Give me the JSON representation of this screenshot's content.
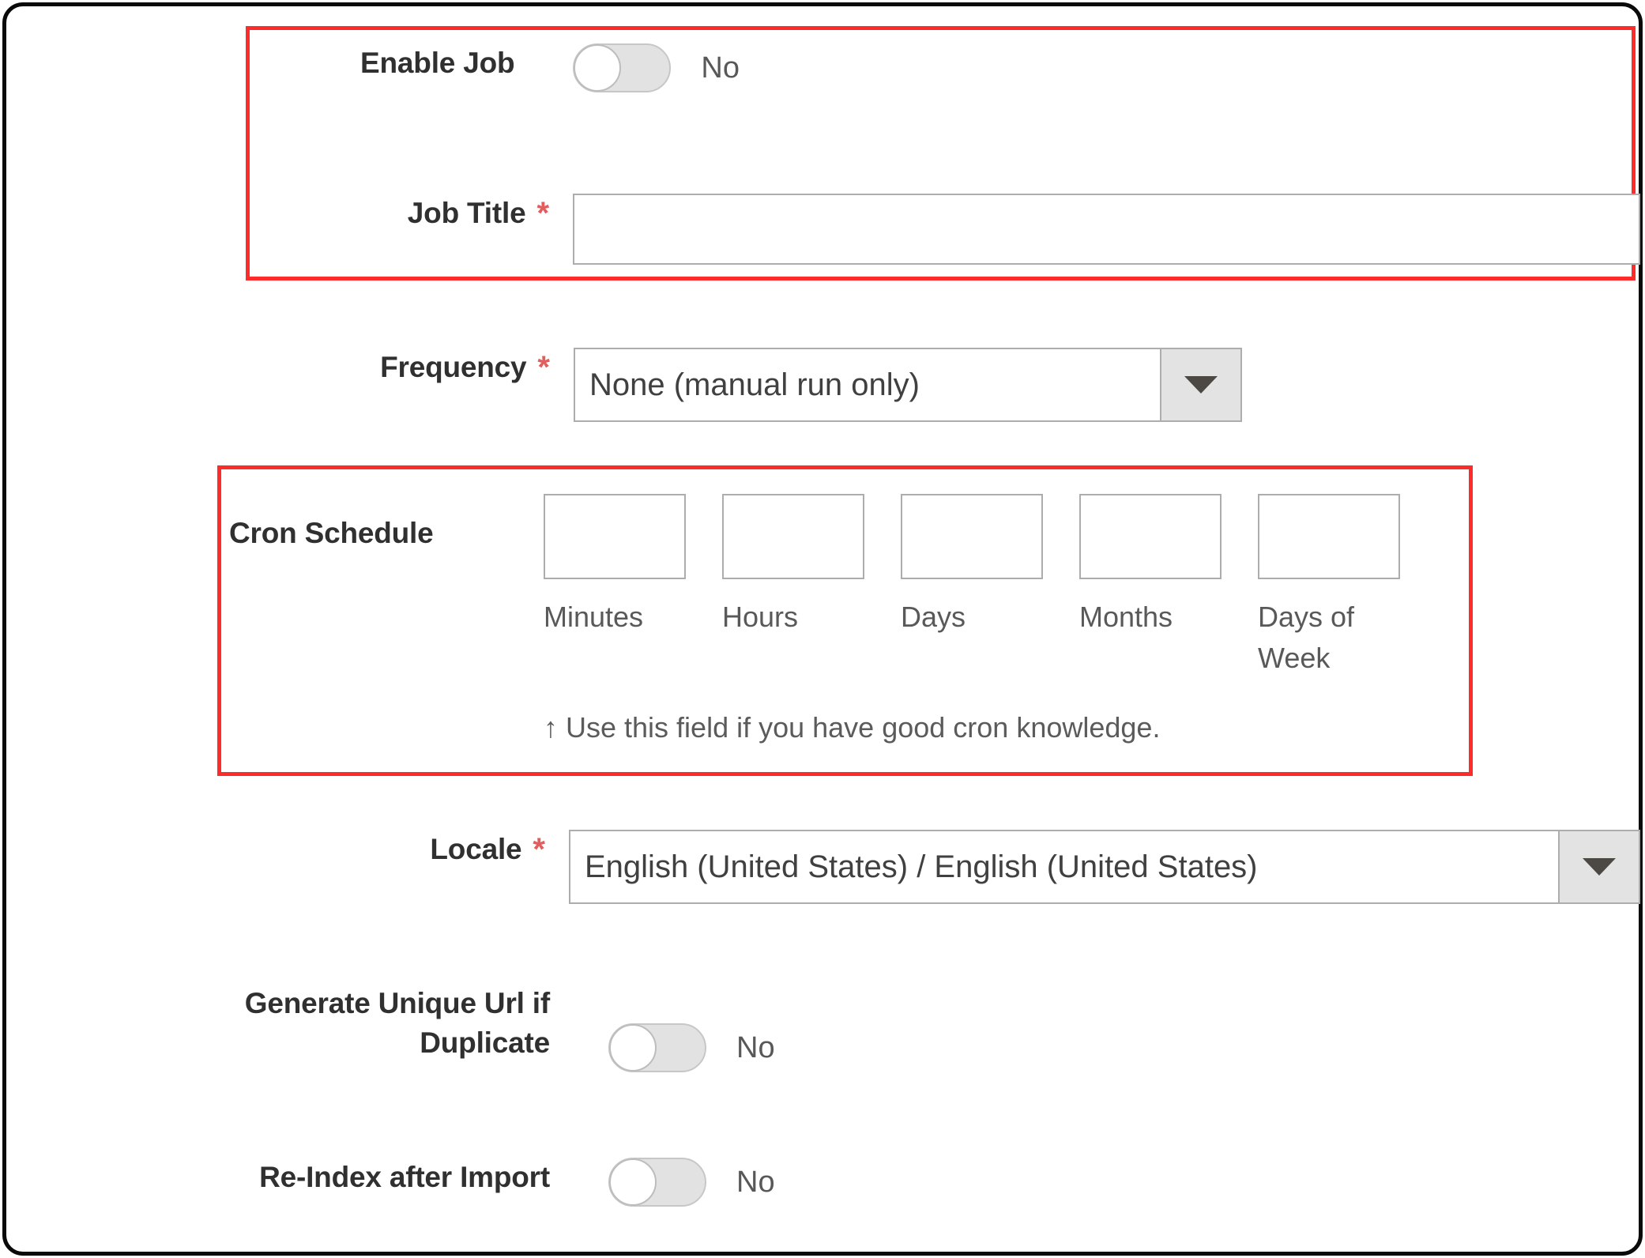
{
  "form": {
    "enable_job": {
      "label": "Enable Job",
      "toggle_value": "No",
      "toggle_state": "off"
    },
    "job_title": {
      "label": "Job Title",
      "required_marker": "*",
      "value": "",
      "placeholder": ""
    },
    "frequency": {
      "label": "Frequency",
      "required_marker": "*",
      "selected": "None (manual run only)"
    },
    "cron_schedule": {
      "label": "Cron Schedule",
      "fields": [
        {
          "caption": "Minutes",
          "value": "",
          "placeholder": ""
        },
        {
          "caption": "Hours",
          "value": "",
          "placeholder": ""
        },
        {
          "caption": "Days",
          "value": "",
          "placeholder": ""
        },
        {
          "caption": "Months",
          "value": "",
          "placeholder": ""
        },
        {
          "caption": "Days of Week",
          "value": "",
          "placeholder": ""
        }
      ],
      "hint": "↑ Use this field if you have good cron knowledge."
    },
    "locale": {
      "label": "Locale",
      "required_marker": "*",
      "selected": "English (United States) / English (United States)"
    },
    "generate_unique_url": {
      "label": "Generate Unique Url if Duplicate",
      "toggle_value": "No",
      "toggle_state": "off"
    },
    "reindex_after_import": {
      "label": "Re-Index after Import",
      "toggle_value": "No",
      "toggle_state": "off"
    }
  },
  "annotations": {
    "highlight_color": "#fe2b2b",
    "boxes": [
      {
        "name": "enable-job-and-job-title"
      },
      {
        "name": "cron-schedule"
      }
    ]
  },
  "colors": {
    "label_text": "#303030",
    "value_text": "#585858",
    "required_asterisk": "#e25d5d",
    "input_border": "#adadad",
    "select_button": "#e3e3e3",
    "toggle_track_off": "#e2e2e2"
  }
}
